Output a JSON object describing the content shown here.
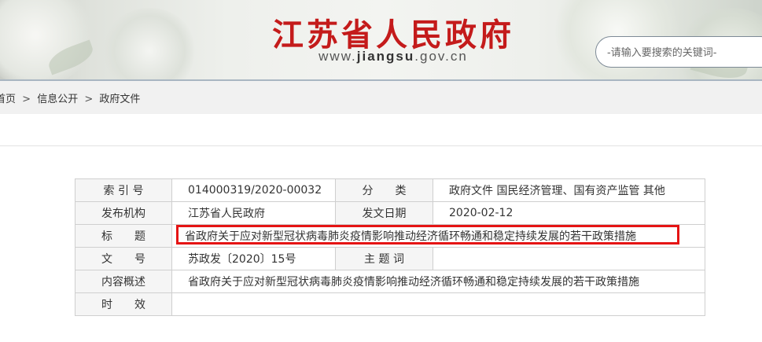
{
  "header": {
    "site_title": "江苏省人民政府",
    "url_prefix": "www.",
    "url_domain": "jiangsu",
    "url_suffix": ".gov.cn",
    "search_placeholder": "-请输入要搜索的关键词-"
  },
  "breadcrumb": {
    "home": "首页",
    "separator": ">",
    "items": [
      "信息公开",
      "政府文件"
    ]
  },
  "info_table": {
    "index_no_label": "索 引 号",
    "index_no": "014000319/2020-00032",
    "category_label": "分　　类",
    "category": "政府文件 国民经济管理、国有资产监管 其他",
    "publisher_label": "发布机构",
    "publisher": "江苏省人民政府",
    "issue_date_label": "发文日期",
    "issue_date": "2020-02-12",
    "title_label": "标　　题",
    "title": "省政府关于应对新型冠状病毒肺炎疫情影响推动经济循环畅通和稳定持续发展的若干政策措施",
    "doc_no_label": "文　　号",
    "doc_no": "苏政发〔2020〕15号",
    "keywords_label": "主 题 词",
    "keywords": "",
    "summary_label": "内容概述",
    "summary": "省政府关于应对新型冠状病毒肺炎疫情影响推动经济循环畅通和稳定持续发展的若干政策措施",
    "validity_label": "时　　效",
    "validity": ""
  },
  "colors": {
    "title_red": "#c41b1b",
    "highlight_red": "#e51414",
    "key_cell_bg": "#f5f5f5"
  }
}
